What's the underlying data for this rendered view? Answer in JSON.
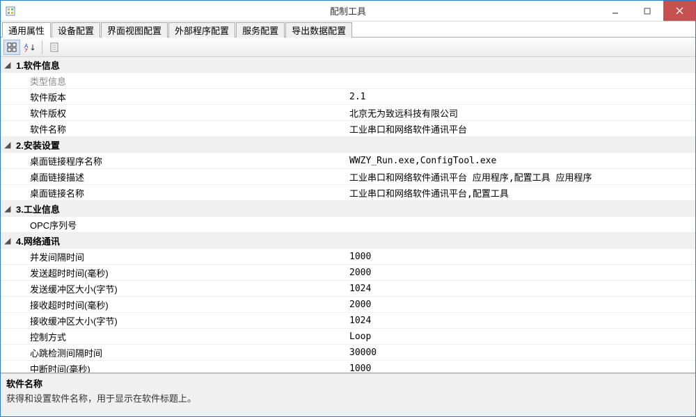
{
  "window": {
    "title": "配制工具"
  },
  "tabs": [
    {
      "label": "通用属性",
      "active": true
    },
    {
      "label": "设备配置"
    },
    {
      "label": "界面视图配置"
    },
    {
      "label": "外部程序配置"
    },
    {
      "label": "服务配置"
    },
    {
      "label": "导出数据配置"
    }
  ],
  "property_grid": {
    "categories": [
      {
        "title": "1.软件信息",
        "expanded": true,
        "items": [
          {
            "label": "类型信息",
            "value": "",
            "dimmed": true
          },
          {
            "label": "软件版本",
            "value": "2.1"
          },
          {
            "label": "软件版权",
            "value": "北京无为致远科技有限公司"
          },
          {
            "label": "软件名称",
            "value": "工业串口和网络软件通讯平台"
          }
        ]
      },
      {
        "title": "2.安装设置",
        "expanded": true,
        "items": [
          {
            "label": "桌面链接程序名称",
            "value": "WWZY_Run.exe,ConfigTool.exe"
          },
          {
            "label": "桌面链接描述",
            "value": "工业串口和网络软件通讯平台 应用程序,配置工具 应用程序"
          },
          {
            "label": "桌面链接名称",
            "value": "工业串口和网络软件通讯平台,配置工具"
          }
        ]
      },
      {
        "title": "3.工业信息",
        "expanded": true,
        "items": [
          {
            "label": "OPC序列号",
            "value": ""
          }
        ]
      },
      {
        "title": "4.网络通讯",
        "expanded": true,
        "items": [
          {
            "label": "并发间隔时间",
            "value": "1000"
          },
          {
            "label": "发送超时时间(毫秒)",
            "value": "2000"
          },
          {
            "label": "发送缓冲区大小(字节)",
            "value": "1024"
          },
          {
            "label": "接收超时时间(毫秒)",
            "value": "2000"
          },
          {
            "label": "接收缓冲区大小(字节)",
            "value": "1024"
          },
          {
            "label": "控制方式",
            "value": "Loop"
          },
          {
            "label": "心跳检测间隔时间",
            "value": "30000"
          },
          {
            "label": "中断时间(毫秒)",
            "value": "1000"
          }
        ]
      }
    ]
  },
  "description": {
    "title": "软件名称",
    "text": "获得和设置软件名称，用于显示在软件标题上。"
  }
}
